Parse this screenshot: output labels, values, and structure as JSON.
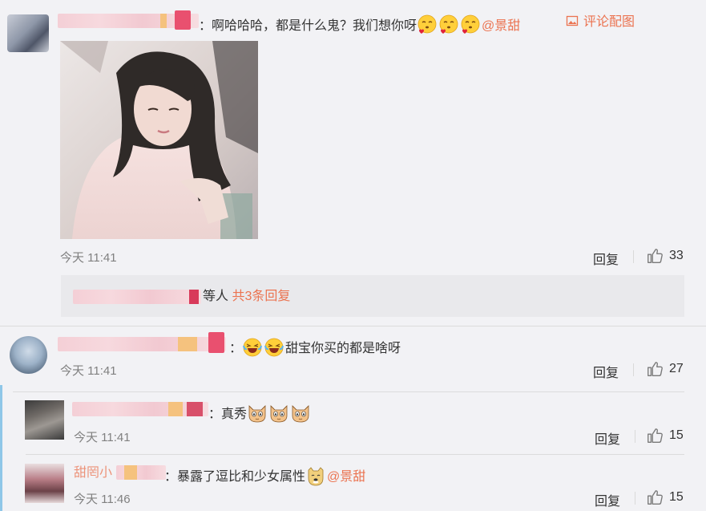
{
  "comments": [
    {
      "text": "：啊哈哈哈，都是什么鬼？我们想你呀",
      "mention": "@景甜",
      "pic_label": "评论配图",
      "time": "今天 11:41",
      "reply_label": "回复",
      "likes": "33",
      "thread_suffix": "等人",
      "thread_link": "共3条回复"
    },
    {
      "text": "甜宝你买的都是啥呀",
      "time": "今天 11:41",
      "reply_label": "回复",
      "likes": "27"
    }
  ],
  "replies": [
    {
      "text": "：真秀",
      "time": "今天 11:41",
      "reply_label": "回复",
      "likes": "15"
    },
    {
      "name": "甜罔小",
      "text": "：暴露了逗比和少女属性",
      "mention": "@景甜",
      "time": "今天 11:46",
      "reply_label": "回复",
      "likes": "15"
    }
  ],
  "icons": {
    "like": "thumbs-up-icon",
    "picture": "picture-icon",
    "emoji_love": "in-love-face-icon",
    "emoji_laugh": "tears-of-joy-icon",
    "emoji_cat": "cat-face-icon",
    "emoji_dog": "doge-icon"
  },
  "colors": {
    "link": "#eb7350",
    "background": "#f2f2f5",
    "accent_bar": "#8fc7e8"
  }
}
